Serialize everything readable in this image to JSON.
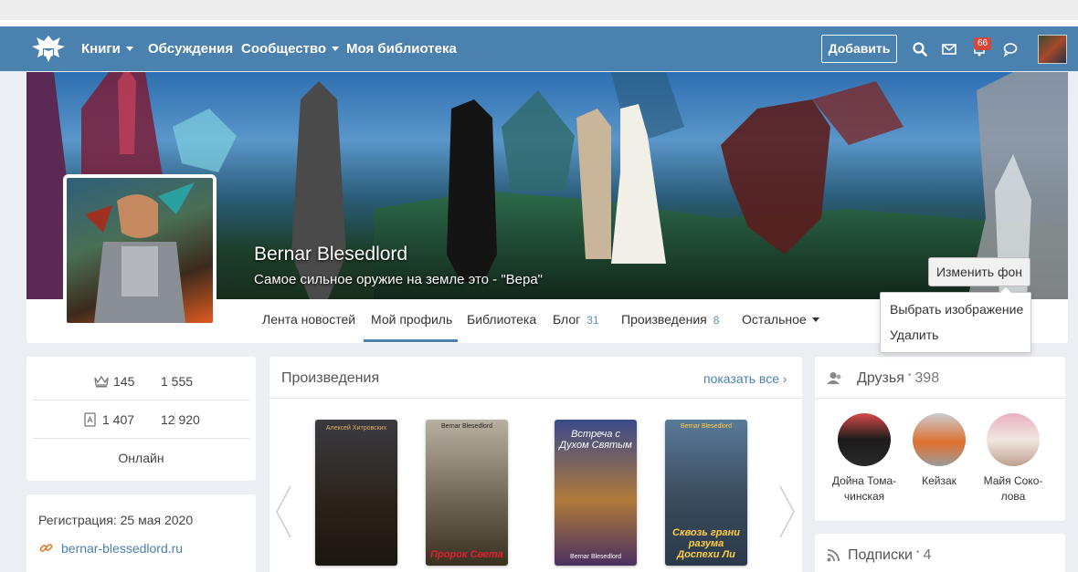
{
  "nav": {
    "items": [
      {
        "label": "Книги",
        "dropdown": true
      },
      {
        "label": "Обсуждения",
        "dropdown": false
      },
      {
        "label": "Сообщество",
        "dropdown": true
      },
      {
        "label": "Моя библиотека",
        "dropdown": false
      }
    ],
    "add_label": "Добавить",
    "notifications_count": "66",
    "icons": [
      "search-icon",
      "mail-icon",
      "bell-icon",
      "chat-icon"
    ],
    "colors": {
      "navbar": "#4a81ae",
      "badge": "#d6473a"
    }
  },
  "profile": {
    "name": "Bernar Blesedlord",
    "status": "Самое сильное оружие на земле это - \"Вера\"",
    "change_bg_label": "Изменить фон",
    "dropdown": [
      "Выбрать изображение",
      "Удалить"
    ]
  },
  "tabs": [
    {
      "label": "Лента новостей",
      "count": ""
    },
    {
      "label": "Мой профиль",
      "count": "",
      "active": true
    },
    {
      "label": "Библиотека",
      "count": ""
    },
    {
      "label": "Блог",
      "count": "31"
    },
    {
      "label": "Произведения",
      "count": "8"
    },
    {
      "label": "Остальное",
      "count": "",
      "dropdown": true
    }
  ],
  "stats": {
    "crown_value": "145",
    "crown_secondary": "1 555",
    "book_value": "1 407",
    "book_secondary": "12 920",
    "online": "Онлайн"
  },
  "info": {
    "registration": "Регистрация: 25 мая 2020",
    "website": "bernar-blessedlord.ru"
  },
  "works": {
    "title": "Произведения",
    "show_all": "показать все",
    "books": [
      {
        "title": "",
        "author": "Алексей Хитровских"
      },
      {
        "title": "Пророк Света",
        "author": "Bernar Blesedlord"
      },
      {
        "title": "Встреча с Духом Святым",
        "author": "Bernar Blesedlord"
      },
      {
        "title": "Сквозь грани разума Доспехи Ли",
        "author": "Bernar Blesedlord"
      }
    ]
  },
  "friends": {
    "title": "Друзья",
    "count": "398",
    "list": [
      {
        "name": "Дойна Тома-чинская"
      },
      {
        "name": "Кейзак"
      },
      {
        "name": "Майя Соко-лова"
      }
    ]
  },
  "subscriptions": {
    "title": "Подписки",
    "count": "4"
  }
}
